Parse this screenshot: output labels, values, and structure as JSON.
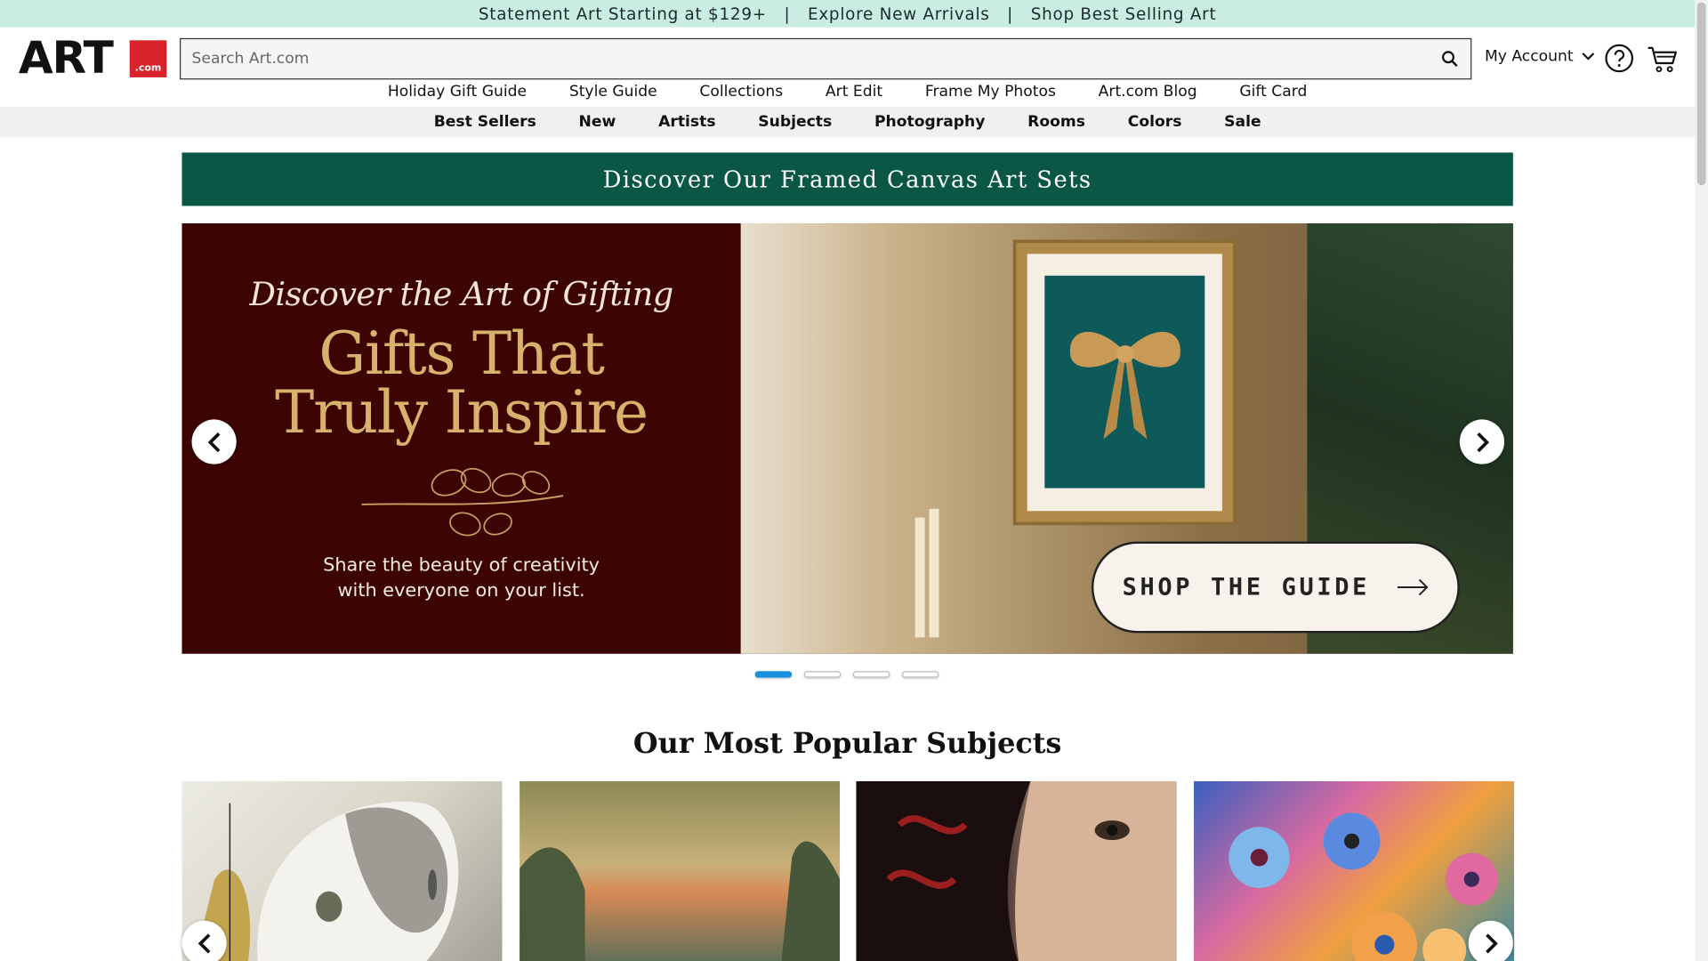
{
  "promo": {
    "item1": "Statement Art Starting at $129+",
    "sep1": "|",
    "item2": "Explore New Arrivals",
    "sep2": "|",
    "item3": "Shop Best Selling Art"
  },
  "logo": {
    "art": "ART",
    "com": ".com"
  },
  "search": {
    "placeholder": "Search Art.com"
  },
  "header": {
    "account_label": "My Account"
  },
  "nav_primary": [
    "Holiday Gift Guide",
    "Style Guide",
    "Collections",
    "Art Edit",
    "Frame My Photos",
    "Art.com Blog",
    "Gift Card"
  ],
  "nav_secondary": [
    "Best Sellers",
    "New",
    "Artists",
    "Subjects",
    "Photography",
    "Rooms",
    "Colors",
    "Sale"
  ],
  "canvas_banner": "Discover Our Framed Canvas Art Sets",
  "hero": {
    "script": "Discover the Art of Gifting",
    "headline_line1": "Gifts That",
    "headline_line2": "Truly Inspire",
    "sub_line1": "Share the beauty of creativity",
    "sub_line2": "with everyone on your list.",
    "cta_label": "SHOP THE GUIDE"
  },
  "carousel": {
    "slide_count": 4,
    "active_index": 0
  },
  "popular": {
    "title": "Our Most Popular Subjects"
  },
  "colors": {
    "promo_bg": "#c9ede2",
    "banner_bg": "#0b5745",
    "hero_left_bg": "#3d0404",
    "headline_gold": "#d7b26c",
    "active_dot": "#1a8fe0"
  }
}
